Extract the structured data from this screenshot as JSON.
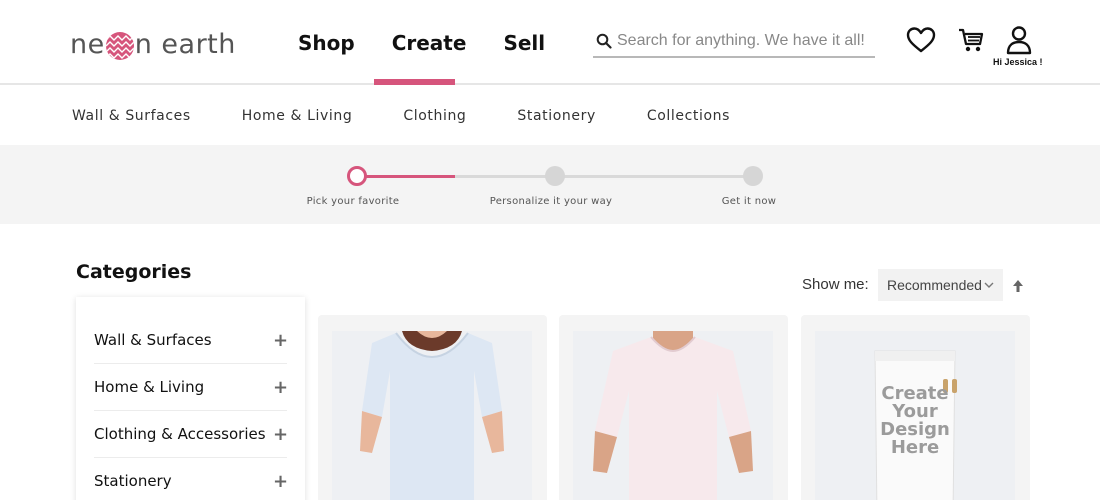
{
  "brand": {
    "logo_left": "ne",
    "logo_right": "n earth",
    "accent": "#d6557c"
  },
  "main_nav": [
    "Shop",
    "Create",
    "Sell"
  ],
  "active_nav": "Create",
  "search": {
    "placeholder": "Search for anything. We have it all!",
    "value": ""
  },
  "header_icons": [
    "heart-icon",
    "cart-icon",
    "user-icon"
  ],
  "user": {
    "greeting": "Hi Jessica !"
  },
  "sub_nav": [
    "Wall & Surfaces",
    "Home & Living",
    "Clothing",
    "Stationery",
    "Collections"
  ],
  "steps": [
    {
      "label": "Pick your favorite",
      "active": true
    },
    {
      "label": "Personalize it your way",
      "active": false
    },
    {
      "label": "Get it now",
      "active": false
    }
  ],
  "categories": {
    "title": "Categories",
    "items": [
      "Wall & Surfaces",
      "Home & Living",
      "Clothing & Accessories",
      "Stationery"
    ]
  },
  "sort": {
    "label": "Show me:",
    "selected": "Recommended"
  },
  "products": [
    {
      "name": "white-tshirt-women"
    },
    {
      "name": "pink-tshirt-men"
    },
    {
      "name": "towel-create-your-design",
      "text_lines": [
        "Create",
        "Your",
        "Design",
        "Here"
      ]
    }
  ]
}
